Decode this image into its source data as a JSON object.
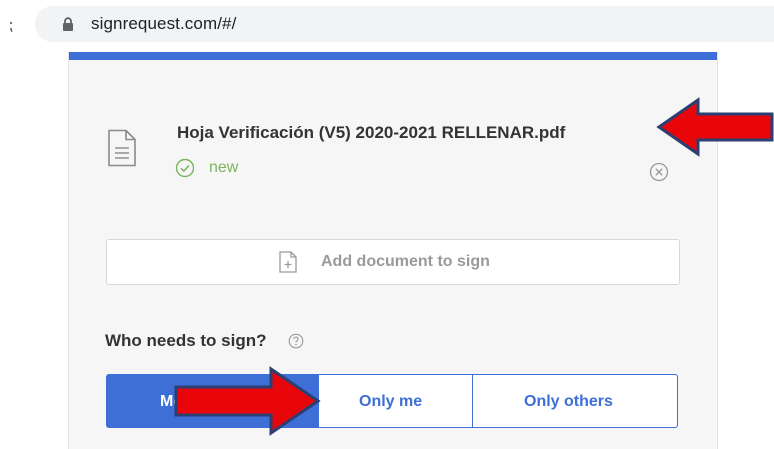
{
  "browser": {
    "url": "signrequest.com/#/",
    "left_glyph": "⁏"
  },
  "document": {
    "filename": "Hoja Verificación (V5) 2020-2021 RELLENAR.pdf",
    "status": "new",
    "icon": "document-icon",
    "status_icon": "check-circle-icon",
    "remove_icon": "close-circle-icon"
  },
  "add_document": {
    "label": "Add document to sign",
    "icon": "file-plus-icon"
  },
  "signers": {
    "question": "Who needs to sign?",
    "help_icon": "question-circle-icon",
    "options": [
      {
        "label": "Me &",
        "selected": true
      },
      {
        "label": "Only me",
        "selected": false
      },
      {
        "label": "Only others",
        "selected": false
      }
    ]
  },
  "colors": {
    "accent": "#3d6fd6",
    "status_green": "#7ab55c",
    "annotation_arrow": "#e8060a",
    "annotation_outline": "#2b3f73"
  }
}
